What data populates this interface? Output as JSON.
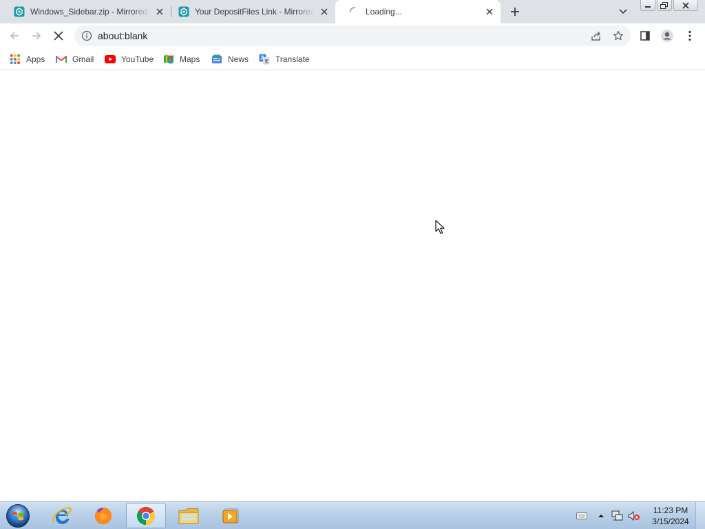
{
  "browser": {
    "tabs": [
      {
        "title": "Windows_Sidebar.zip - Mirrored.to - Mirrorred",
        "favicon": "mirrored-icon",
        "active": false
      },
      {
        "title": "Your DepositFiles Link - Mirrored.to - Mirrorred",
        "favicon": "mirrored-icon",
        "active": false
      },
      {
        "title": "Loading...",
        "favicon": "loading-spinner-icon",
        "active": true
      }
    ],
    "address": {
      "url": "about:blank",
      "icon": "info-icon"
    }
  },
  "bookmarks": [
    {
      "label": "Apps",
      "icon": "apps-grid-icon"
    },
    {
      "label": "Gmail",
      "icon": "gmail-icon"
    },
    {
      "label": "YouTube",
      "icon": "youtube-icon"
    },
    {
      "label": "Maps",
      "icon": "maps-icon"
    },
    {
      "label": "News",
      "icon": "news-icon"
    },
    {
      "label": "Translate",
      "icon": "translate-icon"
    }
  ],
  "taskbar": {
    "apps": [
      {
        "name": "Internet Explorer",
        "icon": "internet-explorer-icon"
      },
      {
        "name": "Firefox",
        "icon": "firefox-icon"
      },
      {
        "name": "Google Chrome",
        "icon": "chrome-icon",
        "active": true
      },
      {
        "name": "Windows Explorer",
        "icon": "folder-icon"
      },
      {
        "name": "Media Player",
        "icon": "media-player-icon"
      }
    ],
    "clock": {
      "time": "11:23 PM",
      "date": "3/15/2024"
    }
  },
  "colors": {
    "tabstrip": "#dee1e6",
    "omnibox": "#f1f3f4",
    "taskbar": "#b9d0e8"
  }
}
